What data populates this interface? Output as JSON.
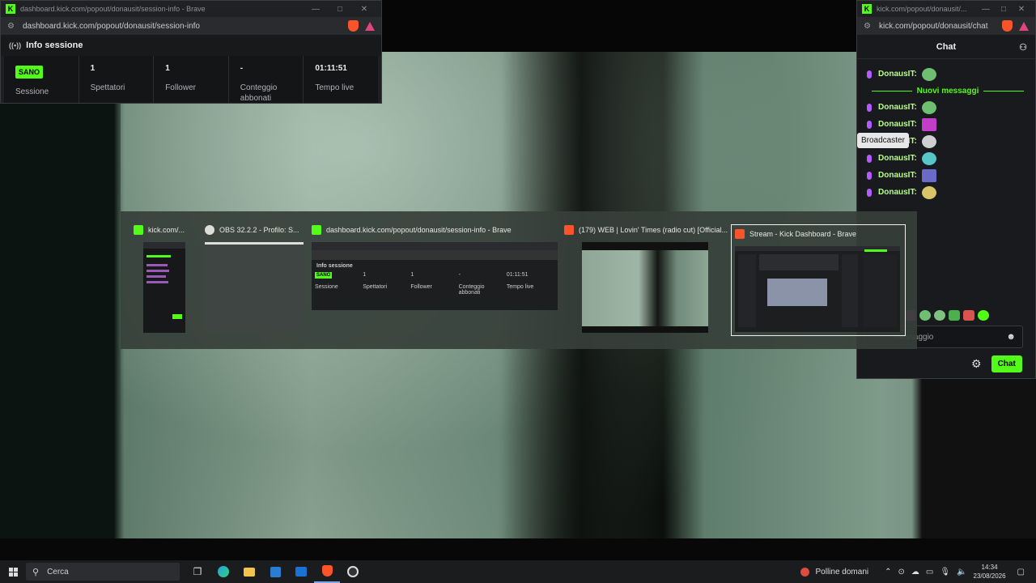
{
  "session_window": {
    "title_bar": "dashboard.kick.com/popout/donausit/session-info - Brave",
    "url": "dashboard.kick.com/popout/donausit/session-info",
    "panel_title": "Info sessione",
    "stats": [
      {
        "value": "SANO",
        "label": "Sessione",
        "is_badge": true
      },
      {
        "value": "1",
        "label": "Spettatori"
      },
      {
        "value": "1",
        "label": "Follower"
      },
      {
        "value": "-",
        "label": "Conteggio abbonati"
      },
      {
        "value": "01:11:51",
        "label": "Tempo live"
      }
    ]
  },
  "chat_window": {
    "title_bar": "kick.com/popout/donausit/...",
    "url": "kick.com/popout/donausit/chat",
    "header": "Chat",
    "new_messages_label": "Nuovi messaggi",
    "tooltip": "Broadcaster",
    "messages": [
      {
        "user": "DonausIT:",
        "emote_color": "#6fbf73"
      },
      {
        "user": "DonausIT:",
        "emote_color": "#6fbf73"
      },
      {
        "user": "DonausIT:",
        "emote_color": "#c23ec9"
      },
      {
        "user": "DonausIT:",
        "emote_color": "#cfcfcf"
      },
      {
        "user": "DonausIT:",
        "emote_color": "#56c6c6"
      },
      {
        "user": "DonausIT:",
        "emote_color": "#6a6ac9"
      },
      {
        "user": "DonausIT:",
        "emote_color": "#d8c56a"
      }
    ],
    "input_placeholder": "messaggio",
    "send_label": "Chat"
  },
  "switcher": {
    "tasks": [
      {
        "title": "kick.com/..."
      },
      {
        "title": "OBS 32.2.2 - Profilo: S..."
      },
      {
        "title": "dashboard.kick.com/popout/donausit/session-info - Brave"
      },
      {
        "title": "(179) WEB | Lovin' Times (radio cut) [Official..."
      },
      {
        "title": "Stream - Kick Dashboard - Brave"
      }
    ],
    "mini_session": {
      "panel_title": "Info sessione",
      "badge": "SANO",
      "labels": [
        "Sessione",
        "Spettatori",
        "Follower",
        "Conteggio abbonati",
        "Tempo live"
      ],
      "values": [
        "1",
        "1",
        "-",
        "01:11:51"
      ]
    }
  },
  "taskbar": {
    "search_label": "Cerca",
    "weather": "Polline domani",
    "time": "14:34",
    "date": "23/08/2026"
  },
  "colors": {
    "accent": "#53fc18",
    "brave": "#fb542b"
  }
}
